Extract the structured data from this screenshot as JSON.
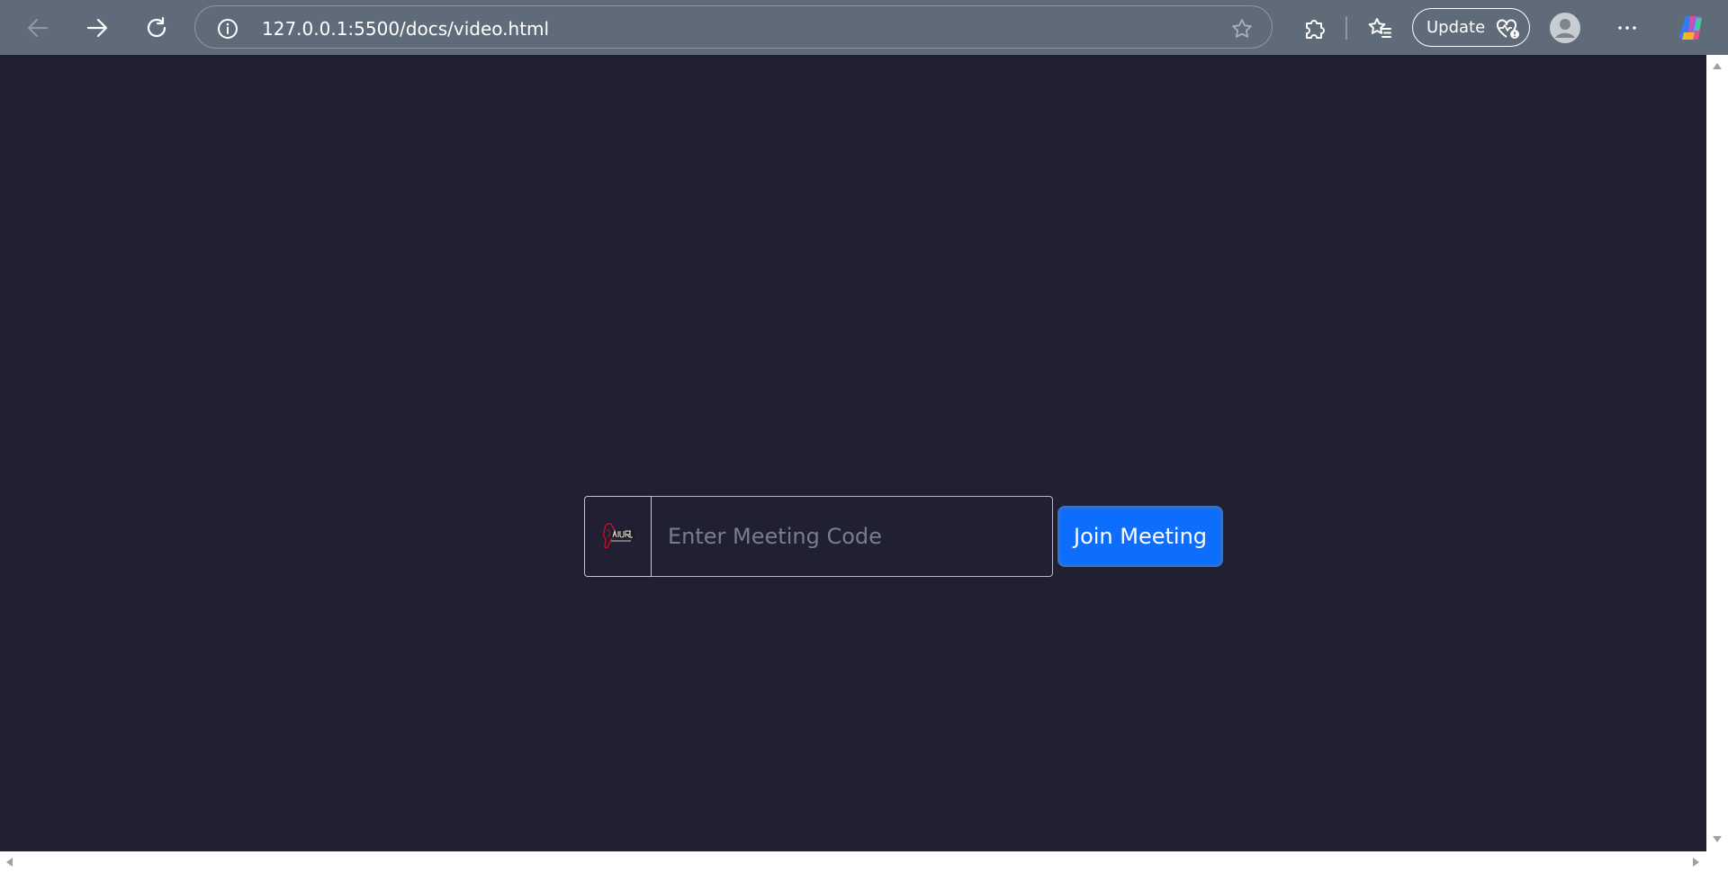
{
  "browser": {
    "url": "127.0.0.1:5500/docs/video.html",
    "update_label": "Update",
    "icons": {
      "back": "back-arrow-icon",
      "forward": "forward-arrow-icon",
      "refresh": "refresh-icon",
      "info": "info-icon",
      "favorite": "star-icon",
      "extensions": "puzzle-icon",
      "favorites": "favorites-icon",
      "profile": "profile-avatar-icon",
      "more": "more-icon",
      "copilot": "copilot-icon"
    },
    "colors": {
      "toolbar": "#5f6b78",
      "page_background": "#202032",
      "accent": "#0d6efd"
    }
  },
  "meeting": {
    "logo_icon": "company-logo-icon",
    "code_placeholder": "Enter Meeting Code",
    "code_value": "",
    "join_label": "Join Meeting"
  }
}
